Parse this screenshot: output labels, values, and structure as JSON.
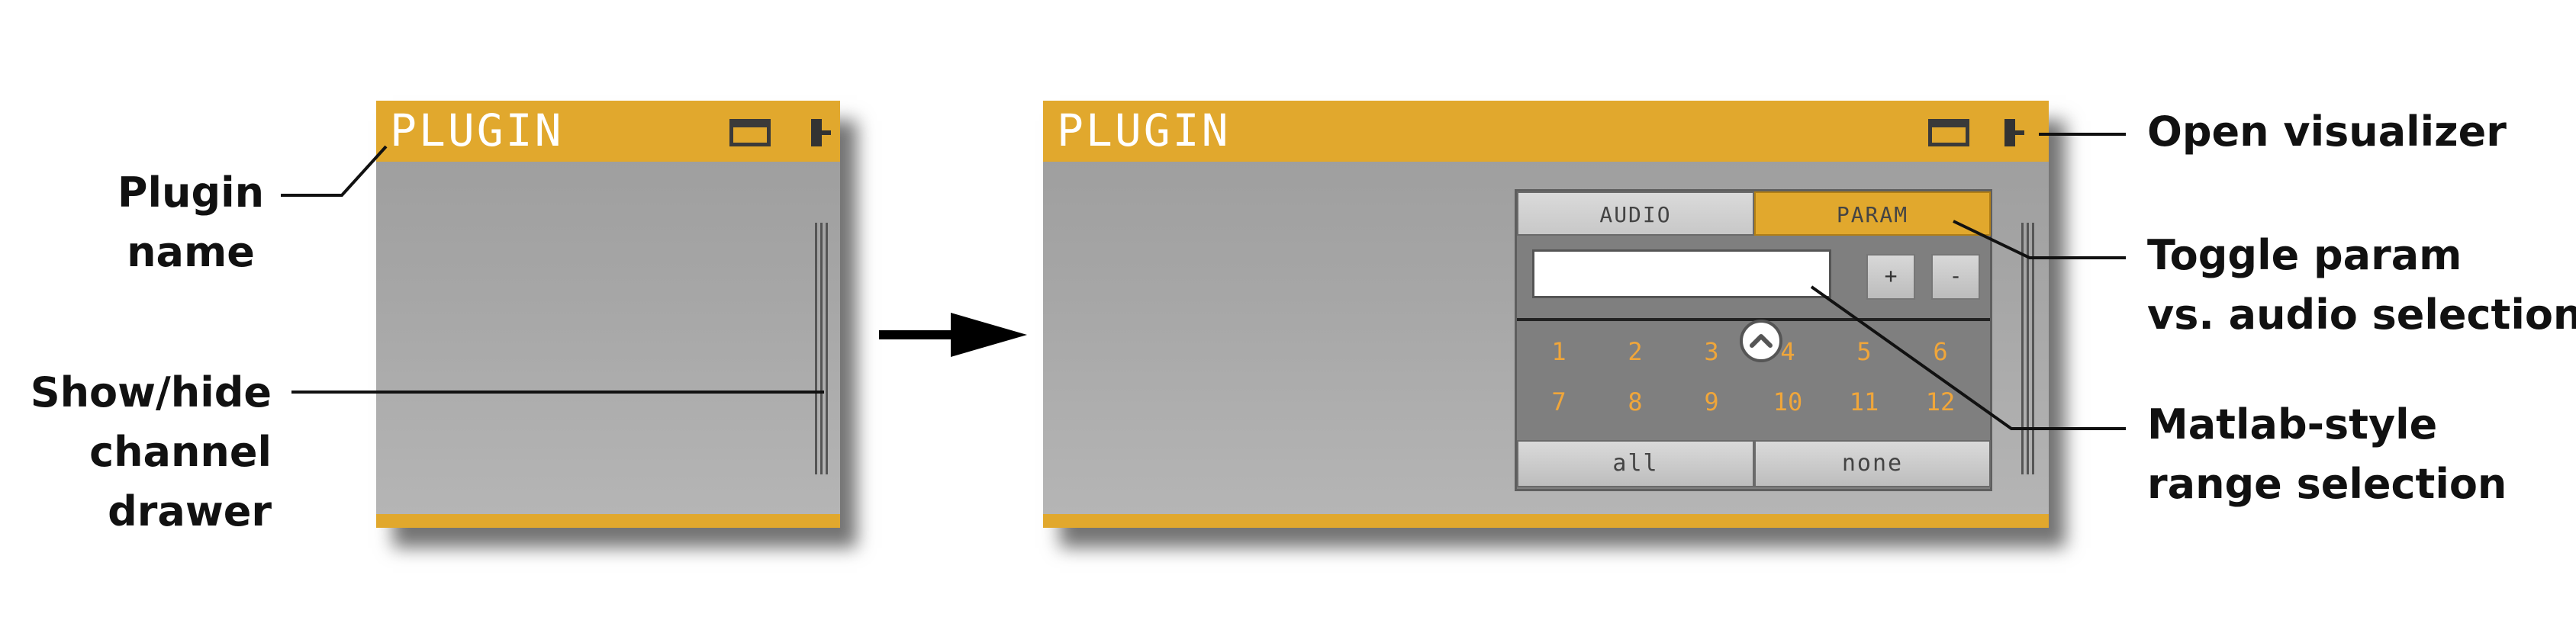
{
  "left_plugin": {
    "title": "PLUGIN"
  },
  "right_plugin": {
    "title": "PLUGIN",
    "tabs": {
      "audio": "AUDIO",
      "param": "PARAM"
    },
    "range_input": {
      "value": ""
    },
    "plus_label": "+",
    "minus_label": "-",
    "channels": [
      "1",
      "2",
      "3",
      "4",
      "5",
      "6",
      "7",
      "8",
      "9",
      "10",
      "11",
      "12"
    ],
    "all_label": "all",
    "none_label": "none"
  },
  "labels": {
    "plugin_name": [
      "Plugin",
      "name"
    ],
    "show_hide_drawer": [
      "Show/hide",
      "channel",
      "drawer"
    ],
    "open_visualizer": "Open visualizer",
    "toggle_param": [
      "Toggle param",
      "vs. audio selection"
    ],
    "matlab_range": [
      "Matlab-style",
      "range selection"
    ]
  },
  "colors": {
    "accent": "#e1a82d",
    "channel_text": "#f0a63a",
    "panel_bg": "#7f7f7f",
    "window_bg": "#a6a6a6"
  },
  "icons": [
    "window-icon",
    "visualizer-icon",
    "drawer-handle-icon",
    "collapse-chevron-icon",
    "arrow-right-icon"
  ]
}
